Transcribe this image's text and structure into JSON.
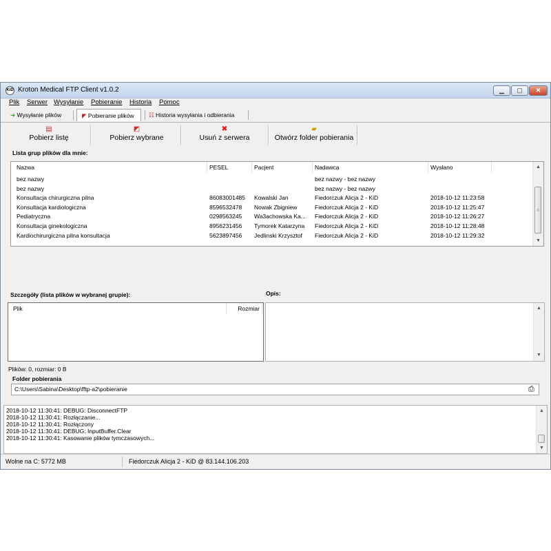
{
  "window": {
    "title": "Kroton Medical FTP Client v1.0.2",
    "icon_text": "KiD",
    "buttons": [
      "minimize",
      "maximize",
      "close"
    ]
  },
  "menu": [
    {
      "label": "Plik"
    },
    {
      "label": "Serwer"
    },
    {
      "label": "Wysyłanie"
    },
    {
      "label": "Pobieranie"
    },
    {
      "label": "Historia"
    },
    {
      "label": "Pomoc"
    }
  ],
  "tabs": [
    {
      "label": "Wysyłanie plików",
      "icon": "green-arrow-icon",
      "active": false
    },
    {
      "label": "Pobieranie plików",
      "icon": "red-arrow-icon",
      "active": true
    },
    {
      "label": "Historia wysyłania i odbierania",
      "icon": "history-list-icon",
      "active": false
    }
  ],
  "toolbar": [
    {
      "label": "Pobierz listę",
      "icon": "list-icon"
    },
    {
      "label": "Pobierz wybrane",
      "icon": "download-icon"
    },
    {
      "label": "Usuń z serwera",
      "icon": "delete-x-icon"
    },
    {
      "label": "Otwórz folder pobierania",
      "icon": "folder-icon"
    }
  ],
  "groups": {
    "label": "Lista grup plików dla mnie:",
    "columns": [
      "Nazwa",
      "PESEL",
      "Pacjent",
      "Nadawca",
      "Wysłano"
    ],
    "rows": [
      [
        "bez nazwy",
        "",
        "",
        "bez nazwy - bez nazwy",
        ""
      ],
      [
        "bez nazwy",
        "",
        "",
        "bez nazwy - bez nazwy",
        ""
      ],
      [
        "Konsultacja chirurgiczna pilna",
        "86083001485",
        "Kowalski Jan",
        "Fiedorczuk Alicja 2 - KiD",
        "2018-10-12 11:23:58"
      ],
      [
        "Konsultacja kardiologiczna",
        "8596532478",
        "Nowak Zbigniew",
        "Fiedorczuk Alicja 2 - KiD",
        "2018-10-12 11:25:47"
      ],
      [
        "Pediatryczna",
        "0298563245",
        "Wa3achowska Ka...",
        "Fiedorczuk Alicja 2 - KiD",
        "2018-10-12 11:26:27"
      ],
      [
        "Konsultacja ginekologiczna",
        "8956231456",
        "Tymorek Katarzyna",
        "Fiedorczuk Alicja 2 - KiD",
        "2018-10-12 11:28:48"
      ],
      [
        "Kardiochirurgiczna pilna konsultacja",
        "5623897456",
        "Jedlinski Krzysztof",
        "Fiedorczuk Alicja 2 - KiD",
        "2018-10-12 11:29:32"
      ]
    ]
  },
  "details": {
    "label": "Szczegóły (lista plików w wybranej grupie):",
    "columns": [
      "Plik",
      "Rozmiar"
    ],
    "summary": "Plików: 0, rozmiar: 0 B"
  },
  "description": {
    "label": "Opis:"
  },
  "download_folder": {
    "label": "Folder pobierania",
    "path": "C:\\Users\\Sabina\\Desktop\\fftp-a2\\pobieranie"
  },
  "log": [
    "2018-10-12 11:30:41: DEBUG: DisconnectFTP",
    "2018-10-12 11:30:41: Rozłączanie...",
    "2018-10-12 11:30:41: Rozłączony",
    "2018-10-12 11:30:41: DEBUG: InputBuffer.Clear",
    "2018-10-12 11:30:41: Kasowanie plików tymczasowych..."
  ],
  "statusbar": {
    "disk": "Wolne na C: 5772 MB",
    "connection": "Fiedorczuk Alicja 2 - KiD @ 83.144.106.203"
  }
}
